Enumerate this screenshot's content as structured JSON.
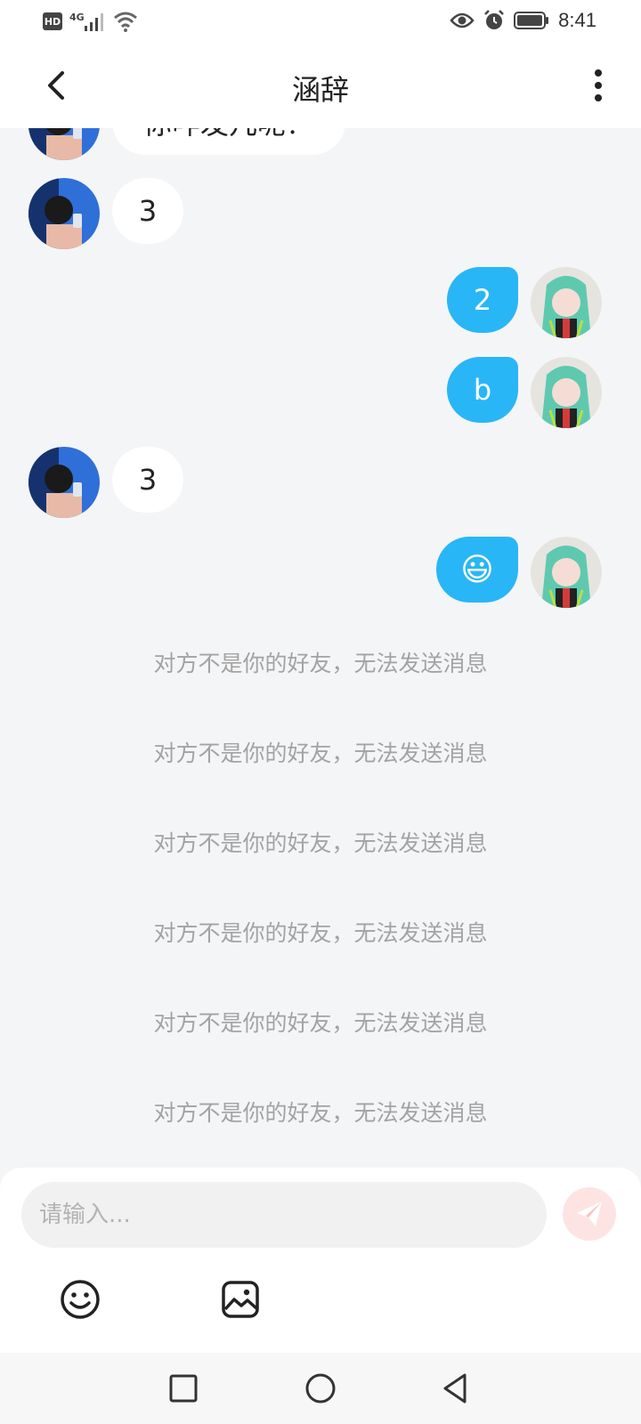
{
  "status_bar": {
    "hd": "HD",
    "network": "4G",
    "time": "8:41",
    "icons": [
      "signal-icon",
      "wifi-icon",
      "eye-icon",
      "alarm-icon",
      "battery-icon"
    ]
  },
  "header": {
    "title": "涵辞",
    "icons": [
      "back-icon",
      "more-vert-icon"
    ]
  },
  "messages": [
    {
      "side": "in",
      "text": "你咋发几呢？"
    },
    {
      "side": "in",
      "text": "3"
    },
    {
      "side": "out",
      "text": "2"
    },
    {
      "side": "out",
      "text": "b"
    },
    {
      "side": "in",
      "text": "3"
    },
    {
      "side": "out",
      "text": "😃"
    }
  ],
  "notices": [
    "对方不是你的好友，无法发送消息",
    "对方不是你的好友，无法发送消息",
    "对方不是你的好友，无法发送消息",
    "对方不是你的好友，无法发送消息",
    "对方不是你的好友，无法发送消息",
    "对方不是你的好友，无法发送消息"
  ],
  "composer": {
    "placeholder": "请输入...",
    "value": "",
    "icons": [
      "send-icon",
      "emoji-icon",
      "image-icon"
    ]
  },
  "nav": {
    "icons": [
      "recent-apps-icon",
      "home-icon",
      "back-nav-icon"
    ]
  },
  "colors": {
    "outgoing_bubble": "#29b6f6",
    "incoming_bubble": "#ffffff",
    "background": "#f4f5f7",
    "notice_text": "#a3a3a3",
    "send_button": "#fde4e2"
  }
}
